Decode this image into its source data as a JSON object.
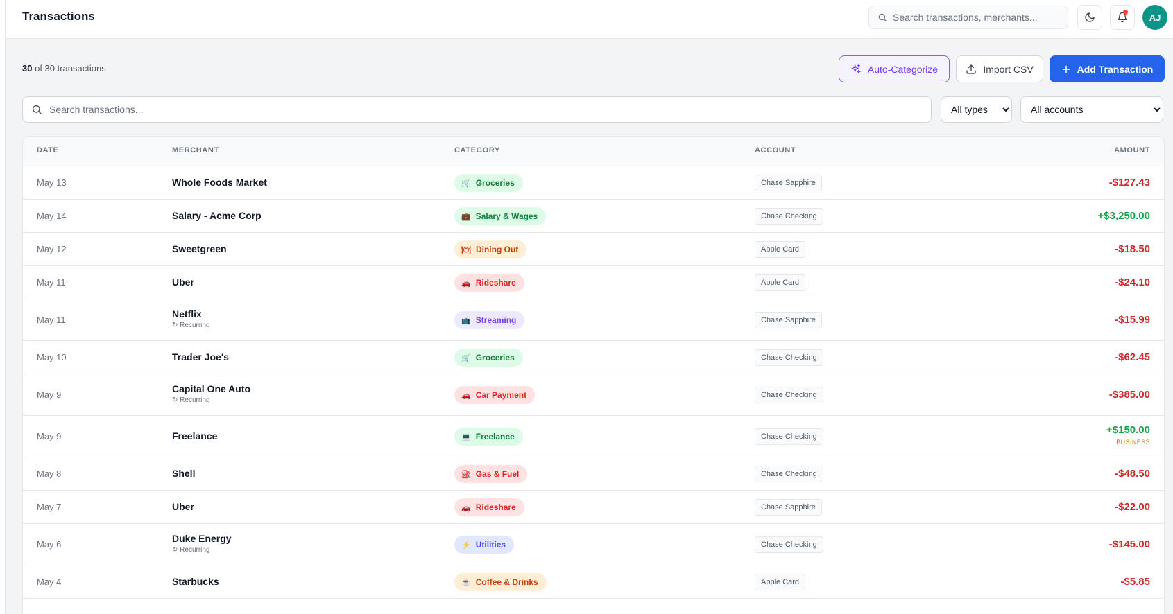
{
  "header": {
    "title": "Transactions",
    "search_placeholder": "Search transactions, merchants...",
    "avatar_initials": "AJ"
  },
  "toolbar": {
    "count_shown": "30",
    "count_rest": "of 30 transactions",
    "auto_categorize_label": "Auto-Categorize",
    "import_label": "Import CSV",
    "add_label": "Add Transaction"
  },
  "filters": {
    "search_placeholder": "Search transactions...",
    "type_selected": "All types",
    "account_selected": "All accounts"
  },
  "table": {
    "headers": {
      "date": "DATE",
      "merchant": "MERCHANT",
      "category": "CATEGORY",
      "account": "ACCOUNT",
      "amount": "AMOUNT"
    },
    "recurring_label": "↻ Recurring",
    "rows": [
      {
        "date": "May 13",
        "merchant": "Whole Foods Market",
        "recurring": false,
        "category": "Groceries",
        "category_icon": "🛒",
        "category_style": "green",
        "account": "Chase Sapphire",
        "amount": "-$127.43",
        "amount_type": "expense",
        "tag": ""
      },
      {
        "date": "May 14",
        "merchant": "Salary - Acme Corp",
        "recurring": false,
        "category": "Salary & Wages",
        "category_icon": "💼",
        "category_style": "green",
        "account": "Chase Checking",
        "amount": "+$3,250.00",
        "amount_type": "income",
        "tag": ""
      },
      {
        "date": "May 12",
        "merchant": "Sweetgreen",
        "recurring": false,
        "category": "Dining Out",
        "category_icon": "🍽",
        "category_style": "orange",
        "account": "Apple Card",
        "amount": "-$18.50",
        "amount_type": "expense",
        "tag": ""
      },
      {
        "date": "May 11",
        "merchant": "Uber",
        "recurring": false,
        "category": "Rideshare",
        "category_icon": "🚗",
        "category_style": "red",
        "account": "Apple Card",
        "amount": "-$24.10",
        "amount_type": "expense",
        "tag": ""
      },
      {
        "date": "May 11",
        "merchant": "Netflix",
        "recurring": true,
        "category": "Streaming",
        "category_icon": "📺",
        "category_style": "purple",
        "account": "Chase Sapphire",
        "amount": "-$15.99",
        "amount_type": "expense",
        "tag": ""
      },
      {
        "date": "May 10",
        "merchant": "Trader Joe's",
        "recurring": false,
        "category": "Groceries",
        "category_icon": "🛒",
        "category_style": "green",
        "account": "Chase Checking",
        "amount": "-$62.45",
        "amount_type": "expense",
        "tag": ""
      },
      {
        "date": "May 9",
        "merchant": "Capital One Auto",
        "recurring": true,
        "category": "Car Payment",
        "category_icon": "🚗",
        "category_style": "red",
        "account": "Chase Checking",
        "amount": "-$385.00",
        "amount_type": "expense",
        "tag": ""
      },
      {
        "date": "May 9",
        "merchant": "Freelance",
        "recurring": false,
        "category": "Freelance",
        "category_icon": "💻",
        "category_style": "green",
        "account": "Chase Checking",
        "amount": "+$150.00",
        "amount_type": "income",
        "tag": "BUSINESS"
      },
      {
        "date": "May 8",
        "merchant": "Shell",
        "recurring": false,
        "category": "Gas & Fuel",
        "category_icon": "⛽",
        "category_style": "red",
        "account": "Chase Checking",
        "amount": "-$48.50",
        "amount_type": "expense",
        "tag": ""
      },
      {
        "date": "May 7",
        "merchant": "Uber",
        "recurring": false,
        "category": "Rideshare",
        "category_icon": "🚗",
        "category_style": "red",
        "account": "Chase Sapphire",
        "amount": "-$22.00",
        "amount_type": "expense",
        "tag": ""
      },
      {
        "date": "May 6",
        "merchant": "Duke Energy",
        "recurring": true,
        "category": "Utilities",
        "category_icon": "⚡",
        "category_style": "indigo",
        "account": "Chase Checking",
        "amount": "-$145.00",
        "amount_type": "expense",
        "tag": ""
      },
      {
        "date": "May 4",
        "merchant": "Starbucks",
        "recurring": false,
        "category": "Coffee & Drinks",
        "category_icon": "☕",
        "category_style": "orange",
        "account": "Apple Card",
        "amount": "-$5.85",
        "amount_type": "expense",
        "tag": ""
      }
    ]
  },
  "colors": {
    "accent_blue": "#2563eb",
    "accent_purple": "#7c3aed",
    "expense_red": "#c53030",
    "income_green": "#16a34a",
    "avatar_teal": "#0d9488",
    "category_styles": {
      "green": {
        "bg": "#dcfce7",
        "fg": "#15803d"
      },
      "orange": {
        "bg": "#ffedd5",
        "fg": "#c2410c"
      },
      "red": {
        "bg": "#fee2e2",
        "fg": "#dc2626"
      },
      "purple": {
        "bg": "#ede9fe",
        "fg": "#7c3aed"
      },
      "indigo": {
        "bg": "#e0e7ff",
        "fg": "#4f46e5"
      }
    }
  },
  "icons": {
    "global_search": "search-icon",
    "theme": "moon-icon",
    "notifications": "bell-icon",
    "auto_categorize": "sparkles-icon",
    "import": "upload-icon",
    "add": "plus-icon",
    "filter_search": "search-icon"
  }
}
